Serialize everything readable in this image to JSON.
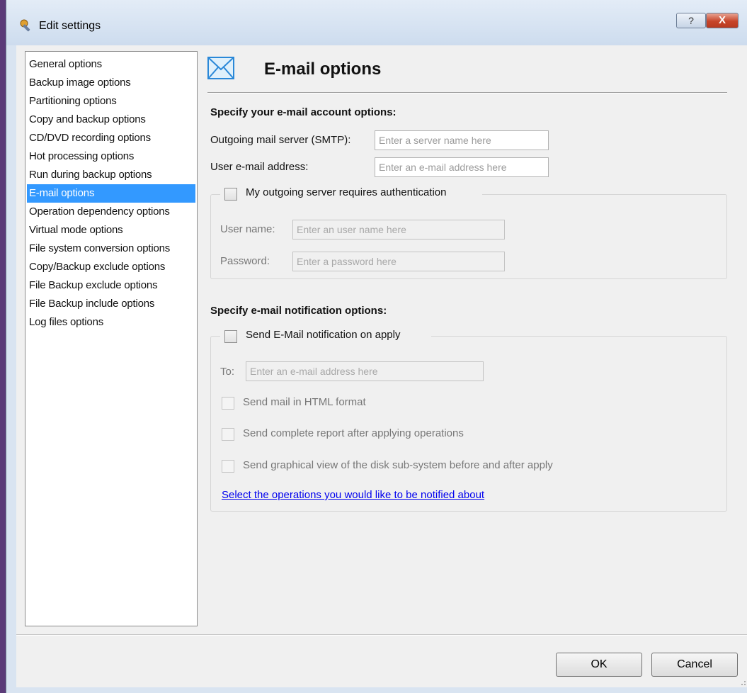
{
  "window": {
    "title": "Edit settings",
    "help_label": "?",
    "close_label": "X"
  },
  "categories": [
    {
      "label": "General options"
    },
    {
      "label": "Backup image options"
    },
    {
      "label": "Partitioning options"
    },
    {
      "label": "Copy and backup options"
    },
    {
      "label": "CD/DVD recording options"
    },
    {
      "label": "Hot processing options"
    },
    {
      "label": "Run during backup options"
    },
    {
      "label": "E-mail options",
      "selected": true
    },
    {
      "label": "Operation dependency options"
    },
    {
      "label": "Virtual mode options"
    },
    {
      "label": "File system conversion options"
    },
    {
      "label": "Copy/Backup exclude options"
    },
    {
      "label": "File Backup exclude options"
    },
    {
      "label": "File Backup include options"
    },
    {
      "label": "Log files options"
    }
  ],
  "page": {
    "title": "E-mail options",
    "icon": "envelope-icon"
  },
  "account": {
    "heading": "Specify your e-mail account options:",
    "smtp_label": "Outgoing mail server (SMTP):",
    "smtp_placeholder": "Enter a server name here",
    "smtp_value": "",
    "email_label": "User e-mail address:",
    "email_placeholder": "Enter an e-mail address here",
    "email_value": "",
    "auth_label": "My outgoing server requires authentication",
    "auth_checked": false,
    "username_label": "User name:",
    "username_placeholder": "Enter an user name here",
    "password_label": "Password:",
    "password_placeholder": "Enter a password here"
  },
  "notification": {
    "heading": "Specify e-mail notification options:",
    "send_label": "Send E-Mail notification on apply",
    "send_checked": false,
    "to_label": "To:",
    "to_placeholder": "Enter an e-mail address here",
    "html_label": "Send mail in HTML format",
    "report_label": "Send complete report after applying operations",
    "graphical_label": "Send graphical view of the disk sub-system before and after apply",
    "link_label": "Select the operations you would like to be notified about"
  },
  "buttons": {
    "ok": "OK",
    "cancel": "Cancel"
  },
  "colors": {
    "selection": "#3399ff",
    "link": "#0000ee",
    "close_button": "#c7452a"
  }
}
